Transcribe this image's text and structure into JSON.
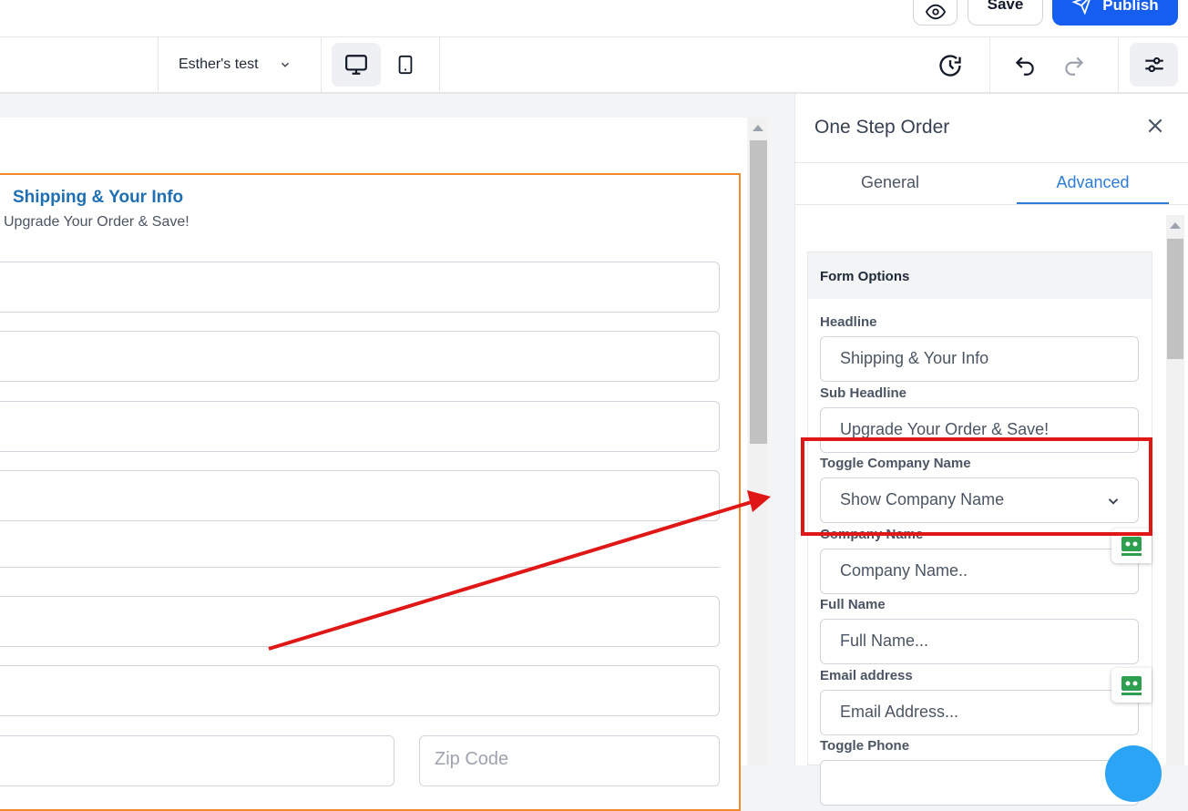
{
  "topbar": {
    "save_label": "Save",
    "publish_label": "Publish"
  },
  "toolbar": {
    "site_name": "Esther's test"
  },
  "canvas": {
    "form_headline": "Shipping & Your Info",
    "form_sub_headline": "Upgrade Your Order & Save!",
    "zip_placeholder": "Zip Code"
  },
  "panel": {
    "title": "One Step Order",
    "tabs": [
      {
        "label": "General",
        "active": false
      },
      {
        "label": "Advanced",
        "active": true
      }
    ],
    "section_title": "Form Options",
    "fields": {
      "headline_label": "Headline",
      "headline_value": "Shipping & Your Info",
      "sub_headline_label": "Sub Headline",
      "sub_headline_value": "Upgrade Your Order & Save!",
      "toggle_company_label": "Toggle Company Name",
      "toggle_company_value": "Show Company Name",
      "company_name_label": "Company Name",
      "company_name_value": "Company Name..",
      "full_name_label": "Full Name",
      "full_name_value": "Full Name...",
      "email_label": "Email address",
      "email_value": "Email Address...",
      "toggle_phone_label": "Toggle Phone"
    }
  },
  "colors": {
    "primary": "#155eef",
    "accent_tab": "#2e7bd6",
    "form_border": "#f28a2c",
    "annotation": "#e01717",
    "headline": "#1f6fb2"
  },
  "icons": {
    "preview": "eye-icon",
    "publish": "send-icon",
    "desktop": "monitor-icon",
    "mobile": "phone-icon",
    "history": "clock-history-icon",
    "undo": "undo-icon",
    "redo": "redo-icon",
    "settings": "sliders-icon",
    "close": "close-icon",
    "dropdown": "chevron-down-icon",
    "helper": "robot-icon"
  }
}
